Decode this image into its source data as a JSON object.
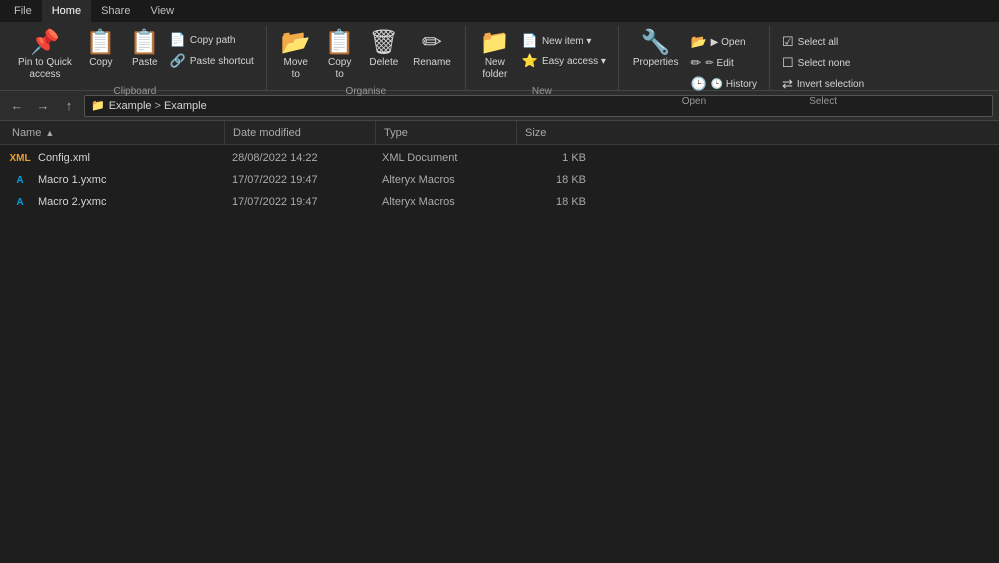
{
  "tabs": [
    {
      "label": "File"
    },
    {
      "label": "Home",
      "active": true
    },
    {
      "label": "Share"
    },
    {
      "label": "View"
    }
  ],
  "ribbon": {
    "groups": [
      {
        "name": "Clipboard",
        "items": [
          {
            "type": "large",
            "label": "Pin to Quick\naccess",
            "icon": "pin"
          },
          {
            "type": "large",
            "label": "Copy",
            "icon": "copy"
          },
          {
            "type": "large-with-small",
            "large": {
              "label": "Paste",
              "icon": "paste"
            },
            "small": [
              {
                "label": "Copy path",
                "icon": "copypath"
              },
              {
                "label": "Paste shortcut",
                "icon": "paste-shortcut"
              }
            ]
          }
        ]
      },
      {
        "name": "Organise",
        "items": [
          {
            "type": "large-with-small",
            "large": {
              "label": "Move\nto",
              "icon": "move"
            },
            "small": []
          },
          {
            "type": "large-with-small",
            "large": {
              "label": "Copy\nto",
              "icon": "copy"
            },
            "small": []
          },
          {
            "type": "large",
            "label": "Delete",
            "icon": "delete"
          },
          {
            "type": "large",
            "label": "Rename",
            "icon": "rename"
          }
        ]
      },
      {
        "name": "New",
        "items": [
          {
            "type": "large",
            "label": "New\nfolder",
            "icon": "new-folder"
          },
          {
            "type": "large-with-small",
            "large": {
              "label": "New item",
              "icon": "new-item"
            },
            "small": [
              {
                "label": "Easy access",
                "icon": "easy"
              }
            ]
          }
        ]
      },
      {
        "name": "Open",
        "items": [
          {
            "type": "large",
            "label": "Properties",
            "icon": "properties"
          },
          {
            "type": "small-col",
            "items": [
              {
                "label": "Open",
                "icon": "open"
              },
              {
                "label": "Edit",
                "icon": "edit"
              },
              {
                "label": "History",
                "icon": "history"
              }
            ]
          }
        ]
      },
      {
        "name": "Select",
        "items": [
          {
            "type": "small-col",
            "items": [
              {
                "label": "Select all",
                "icon": "select-all"
              },
              {
                "label": "Select none",
                "icon": "select-none"
              },
              {
                "label": "Invert selection",
                "icon": "invert"
              }
            ]
          }
        ]
      }
    ]
  },
  "navigation": {
    "back_disabled": false,
    "forward_disabled": false,
    "up_disabled": false,
    "path": [
      "Example",
      "Example"
    ]
  },
  "file_list": {
    "columns": [
      {
        "label": "Name",
        "sort": "asc"
      },
      {
        "label": "Date modified"
      },
      {
        "label": "Type"
      },
      {
        "label": "Size"
      }
    ],
    "files": [
      {
        "name": "Config.xml",
        "date": "28/08/2022 14:22",
        "type": "XML Document",
        "size": "1 KB",
        "icon_type": "xml"
      },
      {
        "name": "Macro 1.yxmc",
        "date": "17/07/2022 19:47",
        "type": "Alteryx Macros",
        "size": "18 KB",
        "icon_type": "alteryx"
      },
      {
        "name": "Macro 2.yxmc",
        "date": "17/07/2022 19:47",
        "type": "Alteryx Macros",
        "size": "18 KB",
        "icon_type": "alteryx"
      }
    ]
  }
}
